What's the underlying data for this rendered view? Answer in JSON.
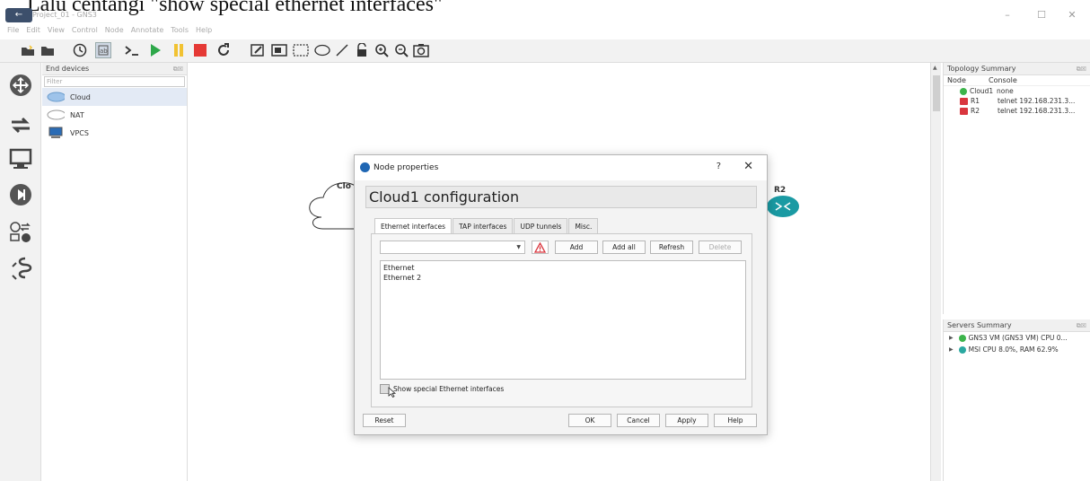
{
  "overlay": {
    "caption": "Lalu centangi \"show special ethernet interfaces\""
  },
  "window": {
    "title": "Project_01 - GNS3",
    "minimize": "–",
    "maximize": "☐",
    "close": "✕"
  },
  "menu": [
    "File",
    "Edit",
    "View",
    "Control",
    "Node",
    "Annotate",
    "Tools",
    "Help"
  ],
  "devices_panel": {
    "title": "End devices",
    "filter_placeholder": "Filter",
    "items": [
      {
        "label": "Cloud",
        "icon": "cloud-icon"
      },
      {
        "label": "NAT",
        "icon": "nat-icon"
      },
      {
        "label": "VPCS",
        "icon": "vpcs-icon"
      }
    ]
  },
  "canvas": {
    "cloud_label": "Clo",
    "router_label": "R2"
  },
  "topology": {
    "title": "Topology Summary",
    "col_node": "Node",
    "col_console": "Console",
    "rows": [
      {
        "node": "Cloud1",
        "console": "none",
        "status": "green"
      },
      {
        "node": "R1",
        "console": "telnet 192.168.231.3...",
        "status": "red"
      },
      {
        "node": "R2",
        "console": "telnet 192.168.231.3...",
        "status": "red"
      }
    ]
  },
  "servers": {
    "title": "Servers Summary",
    "rows": [
      {
        "label": "GNS3 VM (GNS3 VM) CPU 0..."
      },
      {
        "label": "MSI CPU 8.0%, RAM 62.9%"
      }
    ]
  },
  "dialog": {
    "title": "Node properties",
    "help": "?",
    "close": "✕",
    "heading": "Cloud1 configuration",
    "tabs": [
      "Ethernet interfaces",
      "TAP interfaces",
      "UDP tunnels",
      "Misc."
    ],
    "buttons": {
      "add": "Add",
      "add_all": "Add all",
      "refresh": "Refresh",
      "delete": "Delete"
    },
    "interfaces": [
      "Ethernet",
      "Ethernet 2"
    ],
    "checkbox_label": "Show special Ethernet interfaces",
    "footer": {
      "reset": "Reset",
      "ok": "OK",
      "cancel": "Cancel",
      "apply": "Apply",
      "help": "Help"
    }
  },
  "colors": {
    "green": "#3cb44b",
    "red": "#d9363e",
    "cloud_blue": "#9ec3ea",
    "play_green": "#2ea84a",
    "pause_yellow": "#f1c232",
    "stop_red": "#e53935"
  }
}
